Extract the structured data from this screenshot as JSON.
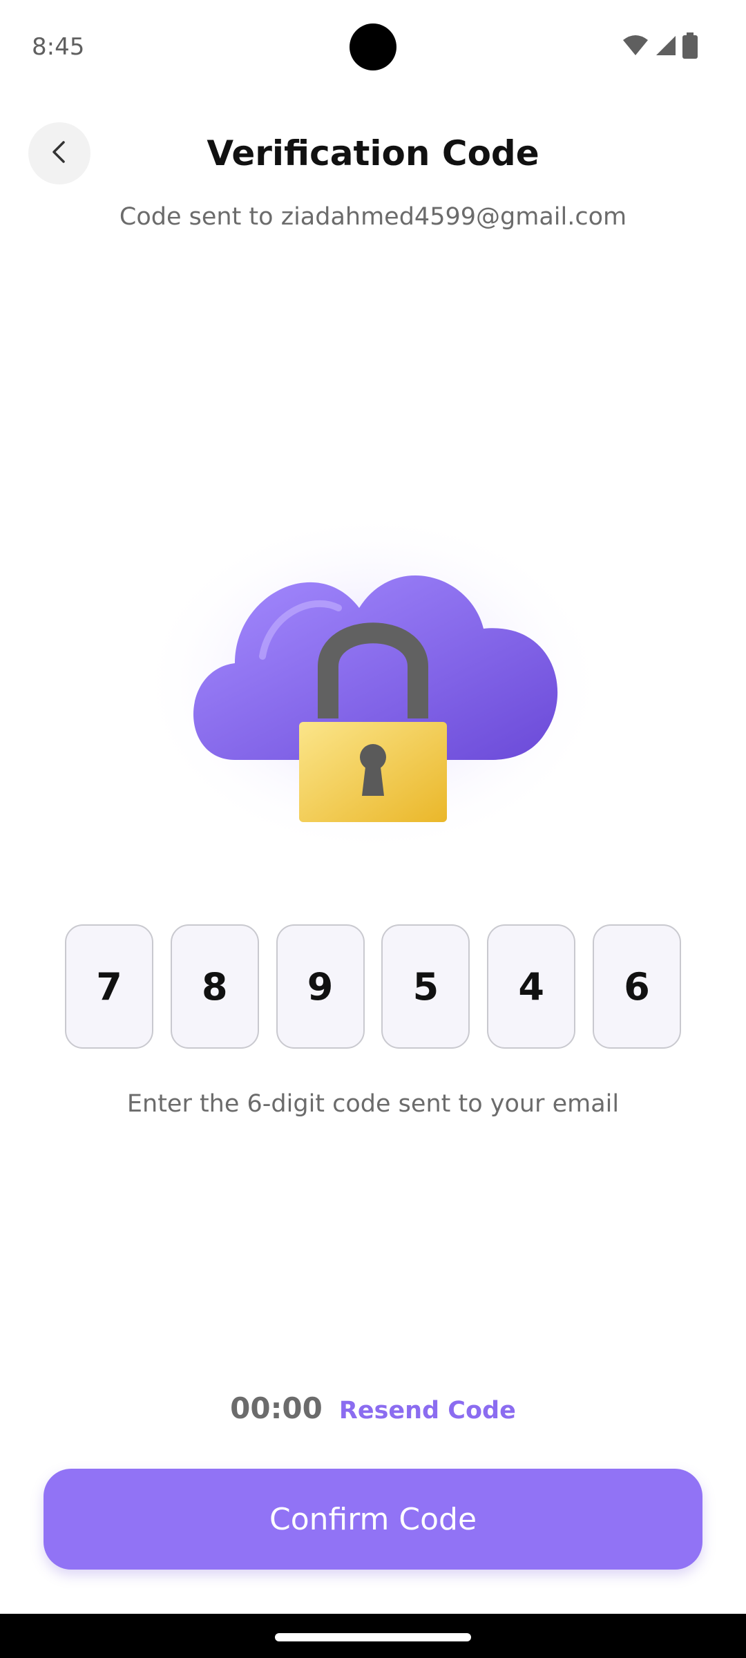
{
  "status_bar": {
    "time": "8:45",
    "icons": [
      "wifi-icon",
      "signal-icon",
      "battery-icon"
    ]
  },
  "header": {
    "back_icon": "chevron-left-icon",
    "title": "Verification Code",
    "subtitle": "Code sent to ziadahmed4599@gmail.com"
  },
  "illustration": {
    "name": "cloud-lock-illustration",
    "colors": {
      "cloud": "#8a6cf0",
      "lock_body": "#f2c94c",
      "shackle": "#616161"
    }
  },
  "code": {
    "digits": [
      "7",
      "8",
      "9",
      "5",
      "4",
      "6"
    ],
    "hint": "Enter the 6-digit code sent to your email"
  },
  "timer": {
    "value": "00:00",
    "resend_label": "Resend Code"
  },
  "confirm": {
    "label": "Confirm Code"
  },
  "colors": {
    "accent": "#9173f5",
    "link": "#8b6cf0",
    "box_background": "#f6f5fb",
    "box_border": "#c9c9cf"
  }
}
